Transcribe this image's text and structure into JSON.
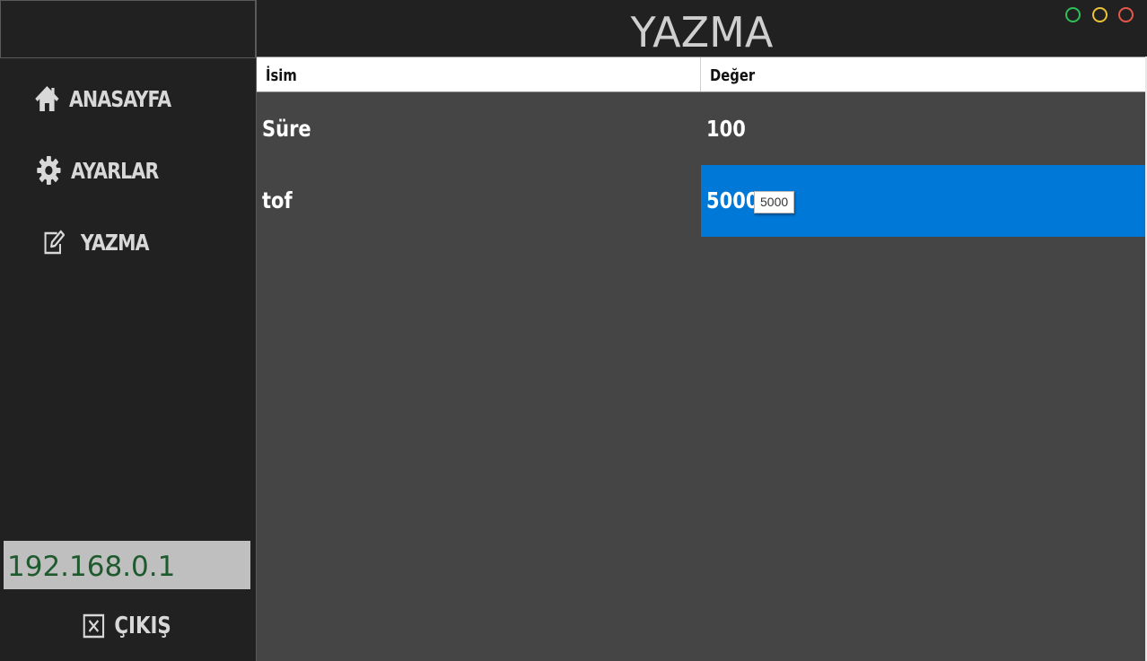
{
  "sidebar": {
    "items": [
      {
        "label": "ANASAYFA",
        "icon": "home-icon"
      },
      {
        "label": "AYARLAR",
        "icon": "gear-icon"
      },
      {
        "label": "YAZMA",
        "icon": "edit-icon"
      }
    ],
    "ip_address": "192.168.0.1",
    "exit_label": "ÇIKIŞ",
    "exit_icon": "close-box-icon"
  },
  "header": {
    "title": "YAZMA",
    "window_buttons": [
      {
        "name": "maximize",
        "color": "#2fbf59"
      },
      {
        "name": "minimize",
        "color": "#e9c23a"
      },
      {
        "name": "close",
        "color": "#e4574b"
      }
    ]
  },
  "grid": {
    "columns": [
      "İsim",
      "Değer"
    ],
    "rows": [
      {
        "name": "Süre",
        "value": "100"
      },
      {
        "name": "tof",
        "value": "5000"
      }
    ],
    "selected_row": 1,
    "tooltip": "5000"
  },
  "colors": {
    "selection": "#0078d7",
    "sidebar_bg": "#212121",
    "content_bg": "#454545",
    "ip_text": "#1e5a2e"
  }
}
